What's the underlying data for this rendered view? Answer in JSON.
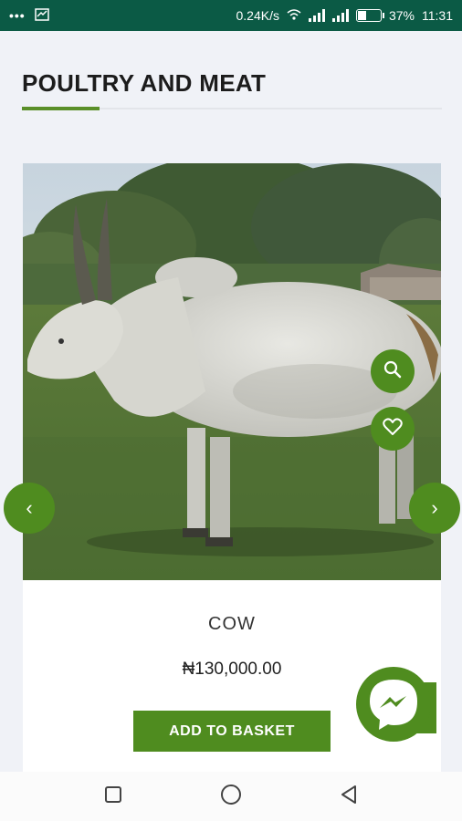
{
  "status_bar": {
    "dots": "•••",
    "speed": "0.24K/s",
    "battery": "37%",
    "time": "11:31"
  },
  "section": {
    "title": "POULTRY AND MEAT"
  },
  "product": {
    "name": "COW",
    "price": "₦130,000.00",
    "add_to_basket": "ADD TO BASKET",
    "image_icon": "cow-photo"
  },
  "carousel": {
    "prev": "‹",
    "next": "›"
  },
  "colors": {
    "accent": "#4f8c1f",
    "status_bar": "#0b5a45"
  },
  "icons": [
    "search-icon",
    "heart-icon",
    "messenger-icon",
    "recent-apps-icon",
    "home-icon",
    "back-icon"
  ]
}
